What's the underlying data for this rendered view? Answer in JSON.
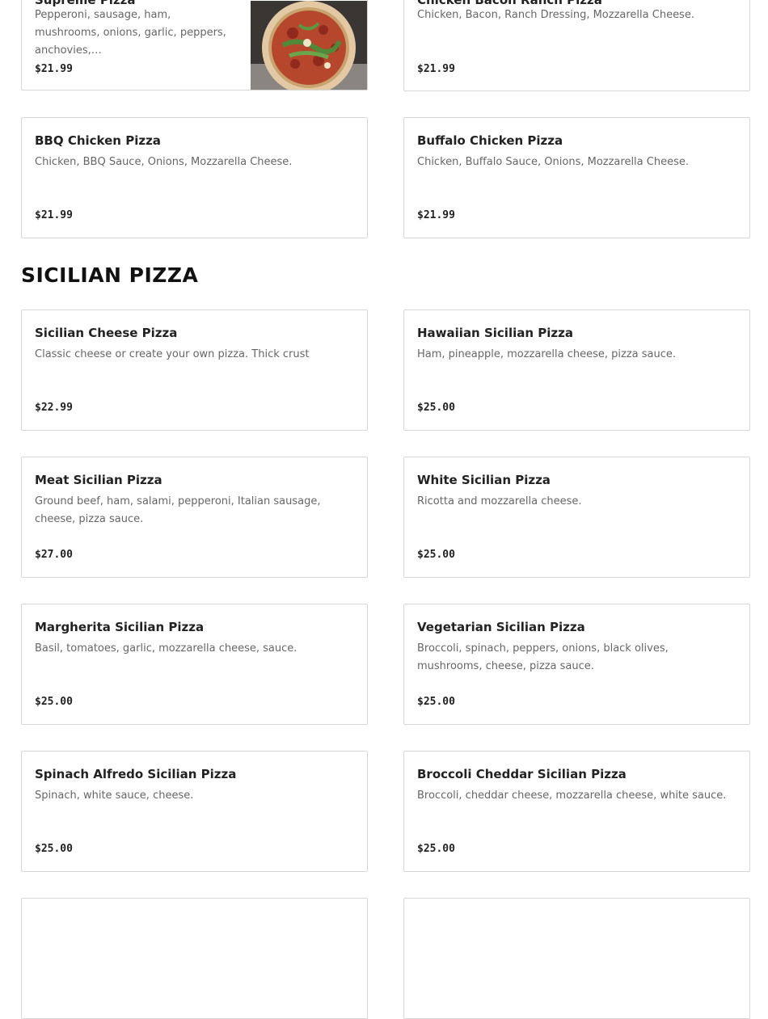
{
  "top_items": [
    {
      "name": "Supreme Pizza",
      "desc": "Pepperoni, sausage, ham, mushrooms, onions, garlic, peppers, anchovies,…",
      "price": "$21.99",
      "image": "pizza-photo"
    },
    {
      "name": "Chicken Bacon Ranch Pizza",
      "desc": "Chicken, Bacon, Ranch Dressing, Mozzarella Cheese.",
      "price": "$21.99"
    },
    {
      "name": "BBQ Chicken Pizza",
      "desc": "Chicken, BBQ Sauce, Onions, Mozzarella Cheese.",
      "price": "$21.99"
    },
    {
      "name": "Buffalo Chicken Pizza",
      "desc": "Chicken, Buffalo Sauce, Onions, Mozzarella Cheese.",
      "price": "$21.99"
    }
  ],
  "section": {
    "title": "SICILIAN PIZZA"
  },
  "sicilian_items": [
    {
      "name": "Sicilian Cheese Pizza",
      "desc": "Classic cheese or create your own pizza. Thick crust",
      "price": "$22.99"
    },
    {
      "name": "Hawaiian Sicilian Pizza",
      "desc": "Ham, pineapple, mozzarella cheese, pizza sauce.",
      "price": "$25.00"
    },
    {
      "name": "Meat Sicilian Pizza",
      "desc": "Ground beef, ham, salami, pepperoni, Italian sausage, cheese, pizza sauce.",
      "price": "$27.00"
    },
    {
      "name": "White Sicilian Pizza",
      "desc": "Ricotta and mozzarella cheese.",
      "price": "$25.00"
    },
    {
      "name": "Margherita Sicilian Pizza",
      "desc": "Basil, tomatoes, garlic, mozzarella cheese, sauce.",
      "price": "$25.00"
    },
    {
      "name": "Vegetarian Sicilian Pizza",
      "desc": "Broccoli, spinach, peppers, onions, black olives, mushrooms, cheese, pizza sauce.",
      "price": "$25.00"
    },
    {
      "name": "Spinach Alfredo Sicilian Pizza",
      "desc": "Spinach, white sauce, cheese.",
      "price": "$25.00"
    },
    {
      "name": "Broccoli Cheddar Sicilian Pizza",
      "desc": "Broccoli, cheddar cheese, mozzarella cheese, white sauce.",
      "price": "$25.00"
    }
  ]
}
